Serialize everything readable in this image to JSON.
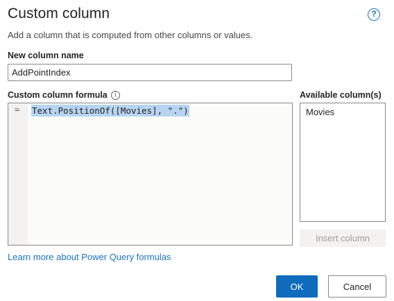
{
  "dialog": {
    "title": "Custom column",
    "subtitle": "Add a column that is computed from other columns or values.",
    "help_icon": "question-circle-icon"
  },
  "name_field": {
    "label": "New column name",
    "value": "AddPointIndex"
  },
  "formula": {
    "label": "Custom column formula",
    "info_icon": "info-circle-icon",
    "gutter_symbol": "=",
    "code": "Text.PositionOf([Movies], \".\")",
    "selected": true
  },
  "available_columns": {
    "label": "Available column(s)",
    "items": [
      "Movies"
    ],
    "insert_button": "Insert column",
    "insert_enabled": false
  },
  "learn_more_link": "Learn more about Power Query formulas",
  "buttons": {
    "ok": "OK",
    "cancel": "Cancel"
  },
  "colors": {
    "accent": "#0f6cbd",
    "link": "#1a73c8",
    "selection": "#b7d4f2"
  }
}
